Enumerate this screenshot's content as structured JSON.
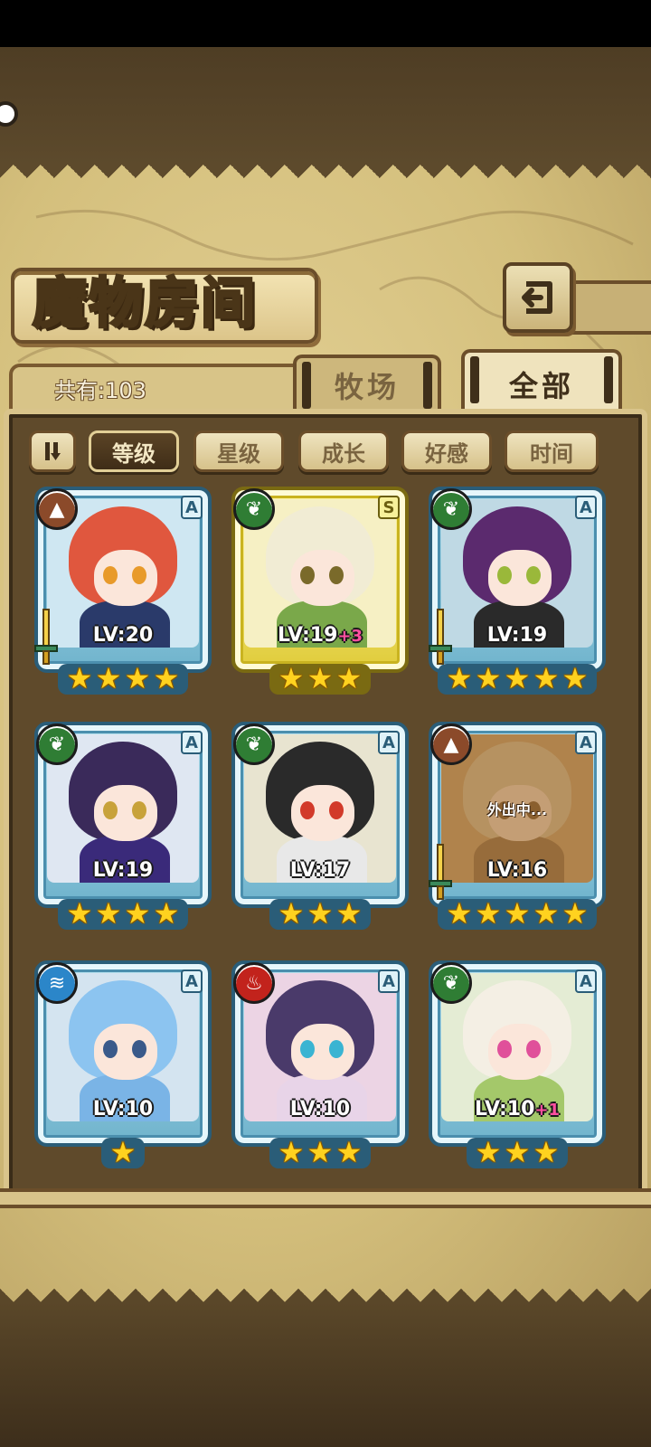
{
  "header": {
    "title": "魔物房间",
    "back_icon": "return-arrow-icon"
  },
  "summary": {
    "count_label": "共有:103"
  },
  "tabs": [
    {
      "label": "牧场",
      "active": false
    },
    {
      "label": "全部",
      "active": true
    }
  ],
  "sort": {
    "toggle_icon": "pause-bars-icon",
    "options": [
      {
        "label": "等级",
        "active": true
      },
      {
        "label": "星级",
        "active": false
      },
      {
        "label": "成长",
        "active": false
      },
      {
        "label": "好感",
        "active": false
      },
      {
        "label": "时间",
        "active": false
      }
    ]
  },
  "monsters": [
    {
      "level": "LV:20",
      "bonus": "",
      "stars": 4,
      "rarity": "A",
      "element": "earth",
      "has_weapon": true,
      "frame": "blue",
      "status": ""
    },
    {
      "level": "LV:19",
      "bonus": "+3",
      "stars": 3,
      "rarity": "S",
      "element": "grass",
      "has_weapon": false,
      "frame": "gold",
      "status": ""
    },
    {
      "level": "LV:19",
      "bonus": "",
      "stars": 5,
      "rarity": "A",
      "element": "grass",
      "has_weapon": true,
      "frame": "blue",
      "status": ""
    },
    {
      "level": "LV:19",
      "bonus": "",
      "stars": 4,
      "rarity": "A",
      "element": "grass",
      "has_weapon": false,
      "frame": "blue",
      "status": ""
    },
    {
      "level": "LV:17",
      "bonus": "",
      "stars": 3,
      "rarity": "A",
      "element": "grass",
      "has_weapon": false,
      "frame": "blue",
      "status": ""
    },
    {
      "level": "LV:16",
      "bonus": "",
      "stars": 5,
      "rarity": "A",
      "element": "earth",
      "has_weapon": true,
      "frame": "blue",
      "status": "外出中..."
    },
    {
      "level": "LV:10",
      "bonus": "",
      "stars": 1,
      "rarity": "A",
      "element": "water",
      "has_weapon": false,
      "frame": "blue",
      "status": ""
    },
    {
      "level": "LV:10",
      "bonus": "",
      "stars": 3,
      "rarity": "A",
      "element": "fire",
      "has_weapon": false,
      "frame": "blue",
      "status": ""
    },
    {
      "level": "LV:10",
      "bonus": "+1",
      "stars": 3,
      "rarity": "A",
      "element": "grass",
      "has_weapon": false,
      "frame": "blue",
      "status": ""
    }
  ],
  "colors": {
    "panel": "#5f4a2b",
    "parchment": "#d4bf7c",
    "card_blue": "#6fb3cc",
    "card_gold": "#e0cc3a",
    "star": "#ffd21f",
    "bonus": "#ff4fa0"
  }
}
